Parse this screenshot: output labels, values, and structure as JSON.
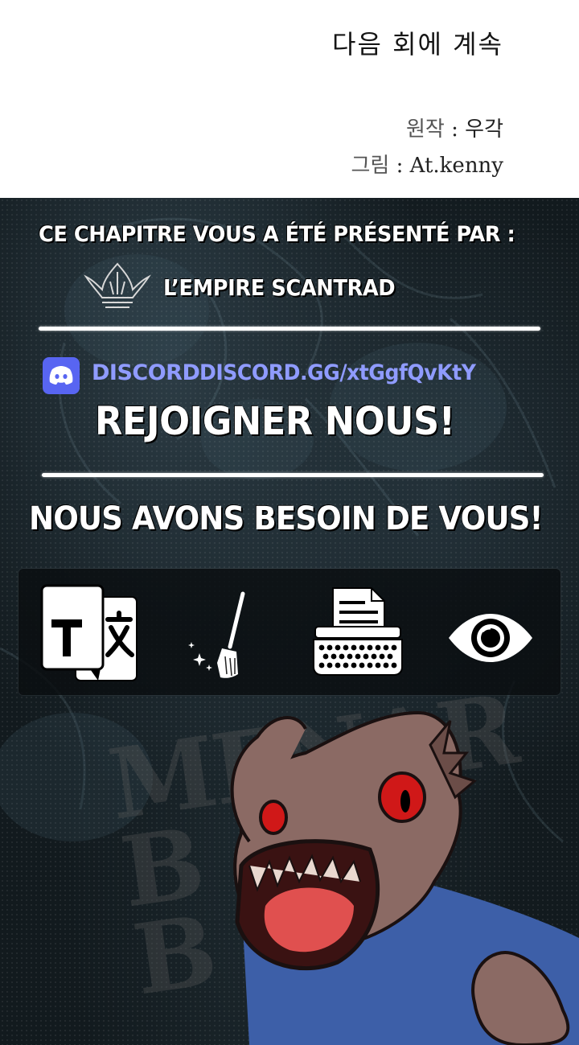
{
  "chapter_end": {
    "to_be_continued": "다음 회에 계속",
    "credits": [
      {
        "label": "원작",
        "sep": " : ",
        "value": "우각"
      },
      {
        "label": "그림",
        "sep": " : ",
        "value": "At.kenny"
      }
    ]
  },
  "banner": {
    "presented_by": "CE CHAPITRE VOUS A ÉTÉ PRÉSENTÉ PAR :",
    "group_name": "L’EMPIRE SCANTRAD",
    "discord_word": "DISCORD",
    "discord_link": "DISCORD.GG/xtGgfQvKtY",
    "join": "REJOIGNER NOUS!",
    "need_you": "NOUS AVONS BESOIN DE VOUS!",
    "roles_icons": [
      "translate-icon",
      "broom-icon",
      "typewriter-icon",
      "eye-icon"
    ],
    "accent_color": "#5865f2"
  }
}
